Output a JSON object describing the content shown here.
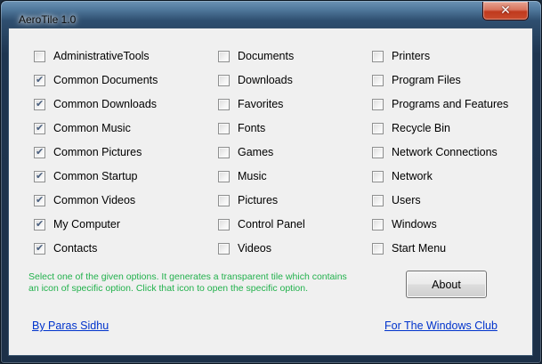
{
  "window": {
    "title": "AeroTile 1.0",
    "close_glyph": "✕",
    "close_icon": "close-icon"
  },
  "options": {
    "col1": [
      {
        "label": "AdministrativeTools",
        "checked": false
      },
      {
        "label": "Common Documents",
        "checked": true
      },
      {
        "label": "Common Downloads",
        "checked": true
      },
      {
        "label": "Common Music",
        "checked": true
      },
      {
        "label": "Common Pictures",
        "checked": true
      },
      {
        "label": "Common Startup",
        "checked": true
      },
      {
        "label": "Common Videos",
        "checked": true
      },
      {
        "label": "My Computer",
        "checked": true
      },
      {
        "label": "Contacts",
        "checked": true
      }
    ],
    "col2": [
      {
        "label": "Documents",
        "checked": false
      },
      {
        "label": "Downloads",
        "checked": false
      },
      {
        "label": "Favorites",
        "checked": false
      },
      {
        "label": "Fonts",
        "checked": false
      },
      {
        "label": "Games",
        "checked": false
      },
      {
        "label": "Music",
        "checked": false
      },
      {
        "label": "Pictures",
        "checked": false
      },
      {
        "label": "Control Panel",
        "checked": false
      },
      {
        "label": "Videos",
        "checked": false
      }
    ],
    "col3": [
      {
        "label": "Printers",
        "checked": false
      },
      {
        "label": "Program Files",
        "checked": false
      },
      {
        "label": "Programs and Features",
        "checked": false
      },
      {
        "label": "Recycle Bin",
        "checked": false
      },
      {
        "label": "Network Connections",
        "checked": false
      },
      {
        "label": "Network",
        "checked": false
      },
      {
        "label": "Users",
        "checked": false
      },
      {
        "label": "Windows",
        "checked": false
      },
      {
        "label": "Start Menu",
        "checked": false
      }
    ]
  },
  "footer": {
    "info_line1": "Select one of the given options. It generates a transparent tile which contains",
    "info_line2": "an icon of specific option. Click that icon to open the specific option.",
    "about_label": "About",
    "author_link": "By Paras Sidhu",
    "club_link": "For The Windows Club"
  },
  "colors": {
    "info_text": "#22b14c",
    "link": "#0033cc",
    "check_mark": "#4a5f7e",
    "close_button": "#c03a1e"
  }
}
